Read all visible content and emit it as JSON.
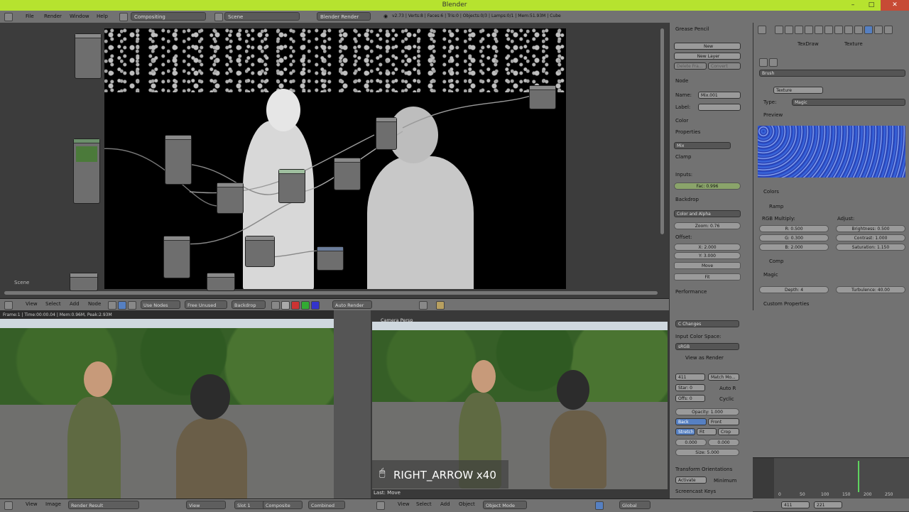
{
  "window": {
    "title": "Blender"
  },
  "info_header": {
    "menus": [
      "File",
      "Render",
      "Window",
      "Help"
    ],
    "screen_layout": "Compositing",
    "scene": "Scene",
    "render_engine": "Blender Render",
    "stats": "v2.73 | Verts:8 | Faces:6 | Tris:0 | Objects:0/3 | Lamps:0/1 | Mem:51.93M | Cube"
  },
  "node_editor": {
    "scene_label": "Scene",
    "header_menus": [
      "View",
      "Select",
      "Add",
      "Node"
    ],
    "use_nodes_label": "Use Nodes",
    "free_unused_label": "Free Unused",
    "backdrop_label": "Backdrop",
    "auto_render_label": "Auto Render"
  },
  "node_panel": {
    "grease_pencil": "Grease Pencil",
    "new_label": "New",
    "new_layer_label": "New Layer",
    "delete_frame": "Delete Fra...",
    "convert": "Convert",
    "node_section": "Node",
    "name_label": "Name:",
    "name_value": "Mix.001",
    "label_label": "Label:",
    "color_section": "Color",
    "properties_section": "Properties",
    "mix_mode": "Mix",
    "clamp": "Clamp",
    "inputs_label": "Inputs:",
    "fac_label": "Fac:",
    "fac_value": "0.996",
    "backdrop_section": "Backdrop",
    "color_alpha": "Color and Alpha",
    "zoom_label": "Zoom:",
    "zoom_value": "0.76",
    "offset_label": "Offset:",
    "x_label": "X:",
    "x_value": "2.000",
    "y_label": "Y:",
    "y_value": "3.000",
    "move_label": "Move",
    "fit_label": "Fit",
    "performance_section": "Performance"
  },
  "texture_props": {
    "tex_source_brush": "Brush",
    "texture_field": "Texture",
    "type_label": "Type:",
    "type_value": "Magic",
    "preview_section": "Preview",
    "colors_section": "Colors",
    "ramp": "Ramp",
    "rgb_multiply": "RGB Multiply:",
    "adjust": "Adjust:",
    "r": "R:",
    "r_value": "0.500",
    "g": "G:",
    "g_value": "0.300",
    "b": "B:",
    "b_value": "2.000",
    "brightness": "Brightness:",
    "brightness_value": "0.500",
    "contrast": "Contrast:",
    "contrast_value": "1.000",
    "saturation": "Saturation:",
    "saturation_value": "1.150",
    "comp": "Comp",
    "magic_section": "Magic",
    "depth": "Depth:",
    "depth_value": "4",
    "turbulence": "Turbulence:",
    "turbulence_value": "40.00",
    "custom_properties": "Custom Properties",
    "tab_texture": "Texture",
    "tab_tex_draw": "TexDraw"
  },
  "image_editor": {
    "frame_text": "Frame:1 | Time:00:00.04 | Mem:0.96M, Peak:2.93M",
    "camera_label": "Camera Persp",
    "overlay_key": "RIGHT_ARROW x40",
    "last_op": "Last: Move",
    "bottom_menus": [
      "View",
      "Image"
    ],
    "render_result": "Render Result",
    "view_label": "View",
    "slot": "Slot 1",
    "composite": "Composite",
    "combined": "Combined",
    "viewport_menus": [
      "View",
      "Select",
      "Add",
      "Object"
    ],
    "object_mode": "Object Mode",
    "global": "Global"
  },
  "image_panel": {
    "c_changes": "C Changes",
    "input_color_space": "Input Color Space:",
    "srgb": "sRGB",
    "view_as_render": "View as Render",
    "frame_len": "411",
    "match_movie": "Match Mo...",
    "start": "Star: 0",
    "auto_r": "Auto R",
    "offset": "Offs: 0",
    "cyclic": "Cyclic",
    "opacity": "Opacity:",
    "opacity_value": "1.000",
    "back": "Back",
    "front": "Front",
    "stretch": "Stretch",
    "fit": "Fit",
    "crop": "Crop",
    "x_value": "0.000",
    "y_value": "0.000",
    "size": "Size:",
    "size_value": "5.000",
    "transform_orientations": "Transform Orientations",
    "activate": "Activate",
    "minimum": "Minimum",
    "screencast_keys": "Screencast Keys"
  },
  "timeline": {
    "ticks": [
      "0",
      "50",
      "100",
      "150",
      "200",
      "250"
    ],
    "frame_start": "411",
    "frame_end": "221"
  }
}
